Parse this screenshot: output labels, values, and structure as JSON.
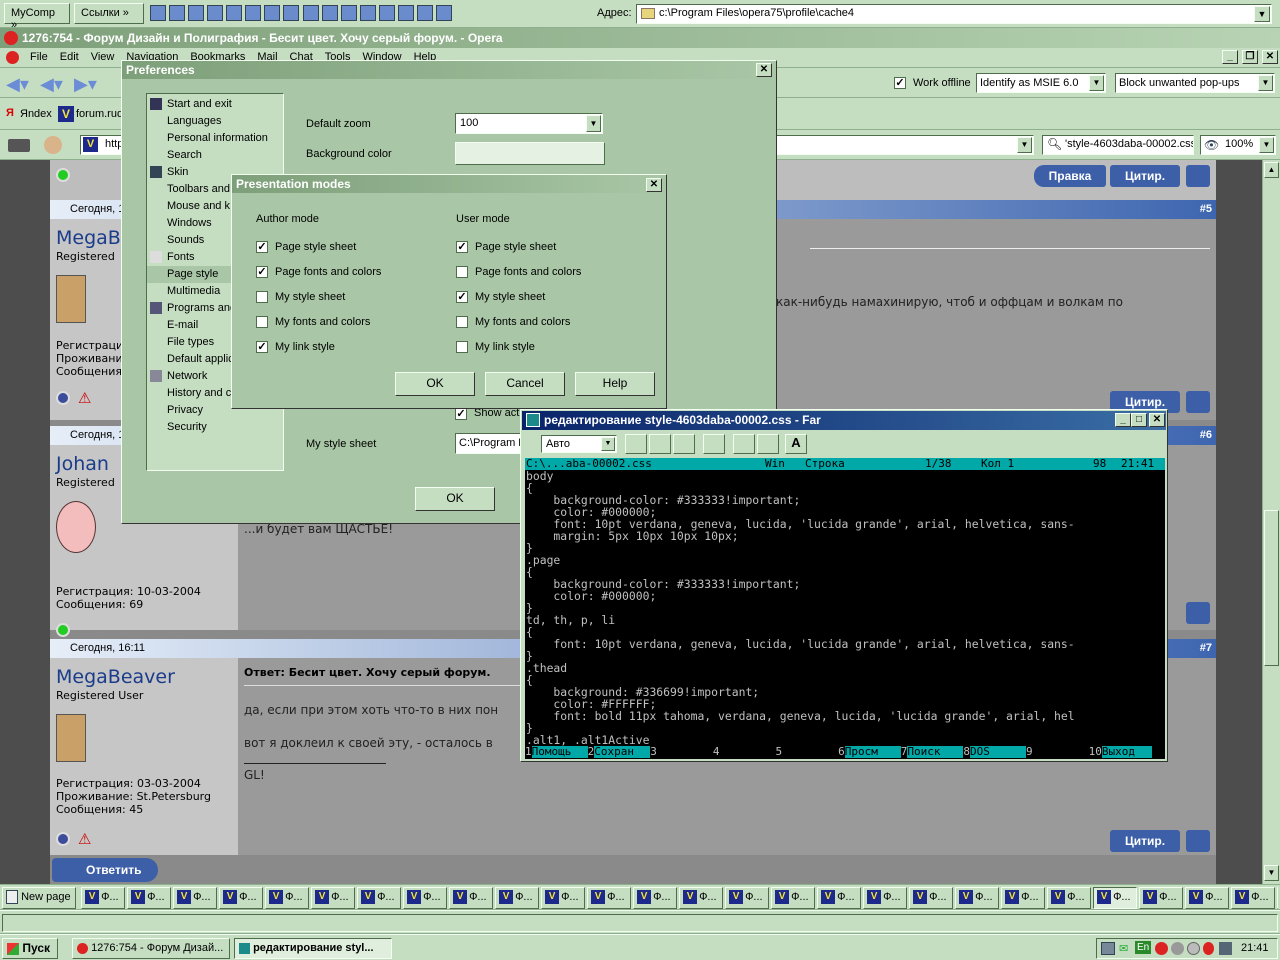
{
  "top_bar": {
    "mycomp": "MyComp",
    "links": "Ссылки",
    "address_label": "Адрес:",
    "address_value": "c:\\Program Files\\opera75\\profile\\cache4"
  },
  "opera": {
    "title": "1276:754 - Форум Дизайн и Полиграфия - Бесит цвет. Хочу серый форум. - Opera",
    "menu": [
      "File",
      "Edit",
      "View",
      "Navigation",
      "Bookmarks",
      "Mail",
      "Chat",
      "Tools",
      "Window",
      "Help"
    ],
    "work_offline": "Work offline",
    "identify": "Identify as MSIE 6.0",
    "popups": "Block unwanted pop-ups",
    "bookmarks": [
      "Яndex",
      "forum.rud"
    ],
    "url_prefix": "http",
    "search_value": "'style-4603daba-00002.css",
    "zoom": "100%"
  },
  "forum": {
    "buttons": {
      "edit": "Правка",
      "quote": "Цитир.",
      "reply": "Ответить"
    },
    "posts": [
      {
        "date": "Сегодня, 1",
        "num": "#5",
        "user": "MegaB",
        "role": "Registered",
        "info": [
          "Регистраци",
          "Проживани",
          "Сообщения"
        ],
        "text": "как-нибудь намахинирую, чтоб и оффцам и волкам по"
      },
      {
        "date": "Сегодня, 1",
        "num": "#6",
        "user": "Johan",
        "role": "Registered",
        "info": [
          "Регистрация: 10-03-2004",
          "Сообщения: 69"
        ],
        "text": "...и будет вам ЩАСТЬЕ!"
      },
      {
        "date": "Сегодня, 16:11",
        "num": "#7",
        "user": "MegaBeaver",
        "role": "Registered User",
        "info": [
          "Регистрация: 03-03-2004",
          "Проживание: St.Petersburg",
          "Сообщения: 45"
        ],
        "title": "Ответ: Бесит цвет. Хочу серый форум.",
        "lines": [
          "да, если при этом хоть что-то в них пон",
          "вот я доклеил к своей эту, - осталось в",
          "GL!"
        ]
      }
    ]
  },
  "preferences": {
    "title": "Preferences",
    "items": [
      "Start and exit",
      "Languages",
      "Personal information",
      "Search",
      "Skin",
      "Toolbars and",
      "Mouse and k",
      "Windows",
      "Sounds",
      "Fonts",
      "Page style",
      "Multimedia",
      "Programs and",
      "E-mail",
      "File types",
      "Default applic",
      "Network",
      "History and c",
      "Privacy",
      "Security"
    ],
    "default_zoom_label": "Default zoom",
    "default_zoom_value": "100",
    "background_color_label": "Background color",
    "show_label": "Show act",
    "my_style_sheet_label": "My style sheet",
    "my_style_sheet_value": "C:\\Program F",
    "ok": "OK"
  },
  "presentation": {
    "title": "Presentation modes",
    "author_header": "Author mode",
    "user_header": "User mode",
    "author": [
      {
        "label": "Page style sheet",
        "checked": true
      },
      {
        "label": "Page fonts and colors",
        "checked": true
      },
      {
        "label": "My style sheet",
        "checked": false
      },
      {
        "label": "My fonts and colors",
        "checked": false
      },
      {
        "label": "My link style",
        "checked": true
      }
    ],
    "user": [
      {
        "label": "Page style sheet",
        "checked": true
      },
      {
        "label": "Page fonts and colors",
        "checked": false
      },
      {
        "label": "My style sheet",
        "checked": true
      },
      {
        "label": "My fonts and colors",
        "checked": false
      },
      {
        "label": "My link style",
        "checked": false
      }
    ],
    "ok": "OK",
    "cancel": "Cancel",
    "help": "Help"
  },
  "far": {
    "title": "редактирование style-4603daba-00002.css - Far",
    "font_select": "Авто",
    "status": {
      "file": "C:\\...aba-00002.css",
      "enc": "Win",
      "line_label": "Строка",
      "pos": "1/38",
      "col_label": "Кол 1",
      "chars": "98",
      "time": "21:41"
    },
    "code": [
      "body",
      "{",
      "    background-color: #333333!important;",
      "    color: #000000;",
      "    font: 10pt verdana, geneva, lucida, 'lucida grande', arial, helvetica, sans-",
      "    margin: 5px 10px 10px 10px;",
      "}",
      ".page",
      "{",
      "    background-color: #333333!important;",
      "    color: #000000;",
      "}",
      "td, th, p, li",
      "{",
      "    font: 10pt verdana, geneva, lucida, 'lucida grande', arial, helvetica, sans-",
      "}",
      ".thead",
      "{",
      "    background: #336699!important;",
      "    color: #FFFFFF;",
      "    font: bold 11px tahoma, verdana, geneva, lucida, 'lucida grande', arial, hel",
      "}",
      ".alt1, .alt1Active"
    ],
    "fkeys": [
      {
        "n": "1",
        "l": "Помощь"
      },
      {
        "n": "2",
        "l": "Сохран"
      },
      {
        "n": "3",
        "l": ""
      },
      {
        "n": "4",
        "l": ""
      },
      {
        "n": "5",
        "l": ""
      },
      {
        "n": "6",
        "l": "Просм"
      },
      {
        "n": "7",
        "l": "Поиск"
      },
      {
        "n": "8",
        "l": "DOS"
      },
      {
        "n": "9",
        "l": ""
      },
      {
        "n": "10",
        "l": "Выход"
      }
    ]
  },
  "tabs": {
    "new_page": "New page",
    "tab_label": "Ф..."
  },
  "taskbar": {
    "start": "Пуск",
    "items": [
      "1276:754 - Форум Дизай...",
      "редактирование styl..."
    ],
    "lang": "En",
    "clock": "21:41"
  }
}
